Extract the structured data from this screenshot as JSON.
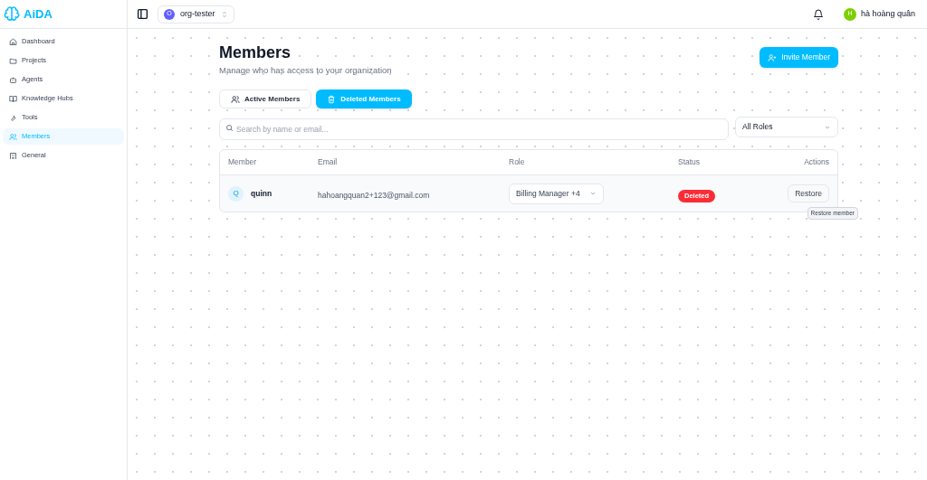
{
  "brand": {
    "name": "AiDA"
  },
  "sidebar": {
    "items": [
      {
        "label": "Dashboard",
        "selected": false
      },
      {
        "label": "Projects",
        "selected": false
      },
      {
        "label": "Agents",
        "selected": false
      },
      {
        "label": "Knowledge Hubs",
        "selected": false
      },
      {
        "label": "Tools",
        "selected": false
      },
      {
        "label": "Members",
        "selected": true
      },
      {
        "label": "General",
        "selected": false
      }
    ]
  },
  "header": {
    "org": {
      "initial": "O",
      "name": "org-tester"
    },
    "user": {
      "initial": "H",
      "name": "hà hoàng quân"
    }
  },
  "page": {
    "title": "Members",
    "subtitle": "Manage who has access to your organization",
    "invite_button": "Invite Member"
  },
  "tabs": [
    {
      "label": "Active Members",
      "selected": false
    },
    {
      "label": "Deleted Members",
      "selected": true
    }
  ],
  "search": {
    "placeholder": "Search by name or email..."
  },
  "role_filter": {
    "value": "All Roles"
  },
  "table": {
    "columns": [
      "Member",
      "Email",
      "Role",
      "Status",
      "Actions"
    ],
    "rows": [
      {
        "initial": "Q",
        "name": "quinn",
        "email": "hahoangquan2+123@gmail.com",
        "role": "Billing Manager +4",
        "status": "Deleted",
        "action": "Restore",
        "tooltip": "Restore member"
      }
    ]
  }
}
